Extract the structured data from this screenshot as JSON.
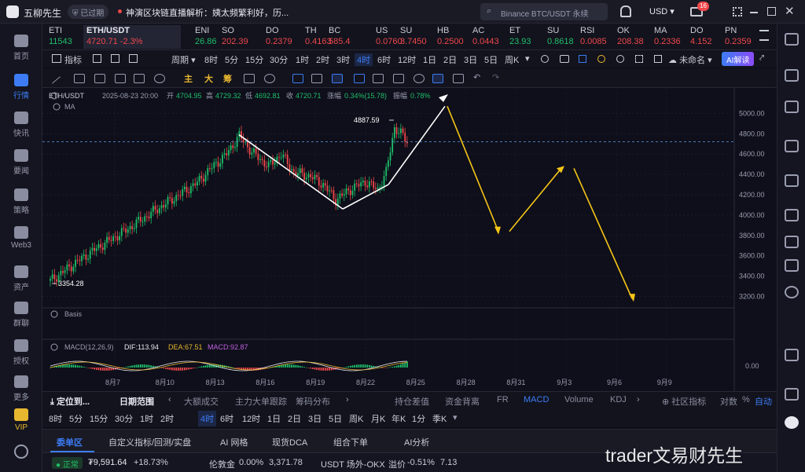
{
  "titlebar": {
    "app_name": "五柳先生",
    "expired_badge": "已过期",
    "news": "神演区块链直播解析：姨太频繁利好，历...",
    "search_placeholder": "Binance BTC/USDT 永续",
    "currency": "USD",
    "mail_count": "16"
  },
  "leftnav": [
    {
      "label": "首页"
    },
    {
      "label": "行情"
    },
    {
      "label": "快讯"
    },
    {
      "label": "要闻"
    },
    {
      "label": "策略"
    },
    {
      "label": "Web3"
    },
    {
      "label": "资产"
    },
    {
      "label": "群聊"
    },
    {
      "label": "授权"
    },
    {
      "label": "更多"
    },
    {
      "label": "VIP"
    }
  ],
  "ticker": [
    {
      "name": "ETI",
      "price": "11543",
      "change": ""
    },
    {
      "name": "ETH/USDT",
      "price": "4720.71",
      "change": "-2.3%"
    },
    {
      "name": "ENI",
      "price": "26.86",
      "change": ""
    },
    {
      "name": "SO",
      "price": "202.39",
      "change": ""
    },
    {
      "name": "DO",
      "price": "0.2379",
      "change": ""
    },
    {
      "name": "TH",
      "price": "0.4163",
      "change": ""
    },
    {
      "name": "BC",
      "price": "585.4",
      "change": ""
    },
    {
      "name": "US",
      "price": "0.0760",
      "change": ""
    },
    {
      "name": "SU",
      "price": "3.7450",
      "change": ""
    },
    {
      "name": "HB",
      "price": "0.2500",
      "change": ""
    },
    {
      "name": "AC",
      "price": "0.0443",
      "change": ""
    },
    {
      "name": "ET",
      "price": "23.93",
      "change": ""
    },
    {
      "name": "SU",
      "price": "0.8618",
      "change": ""
    },
    {
      "name": "RSI",
      "price": "0.0085",
      "change": ""
    },
    {
      "name": "OK",
      "price": "208.38",
      "change": ""
    },
    {
      "name": "MA",
      "price": "0.2336",
      "change": ""
    },
    {
      "name": "DO",
      "price": "4.152",
      "change": ""
    },
    {
      "name": "PN",
      "price": "0.2359",
      "change": ""
    }
  ],
  "toolbar1": {
    "indicators": "指标",
    "period_label": "周期",
    "periods": [
      "8时",
      "5分",
      "15分",
      "30分",
      "1时",
      "2时",
      "3时",
      "4时",
      "6时",
      "12时",
      "1日",
      "2日",
      "3日",
      "5日",
      "周K"
    ],
    "active_period": "4时",
    "unnamed": "未命名",
    "ai_read": "AI解读"
  },
  "toolbar2": {
    "tags": [
      "主",
      "大",
      "筹"
    ]
  },
  "chart_data": {
    "type": "candlestick",
    "symbol": "ETH/USDT",
    "info": {
      "datetime": "2025-08-23 20:00",
      "open_label": "开",
      "open": "4704.95",
      "high_label": "高",
      "high": "4729.32",
      "low_label": "低",
      "low": "4692.81",
      "close_label": "收",
      "close": "4720.71",
      "change_label": "涨幅",
      "change": "0.34%(15.78)",
      "amp_label": "振幅",
      "amp": "0.78%"
    },
    "ma_label": "MA",
    "ylim": [
      3150,
      5080
    ],
    "yticks": [
      5000,
      4800,
      4600,
      4400,
      4200,
      4000,
      3800,
      3600,
      3400,
      3200
    ],
    "xticks": [
      "8月7",
      "8月10",
      "8月13",
      "8月16",
      "8月19",
      "8月22",
      "8月25",
      "8月28",
      "8月31",
      "9月3",
      "9月6",
      "9月9"
    ],
    "max_label": "4887.59",
    "min_label": "3354.28",
    "current_price": 4720.71,
    "basis_label": "Basis",
    "macd": {
      "label": "MACD(12,26,9)",
      "dif_label": "DIF:113.94",
      "dea_label": "DEA:67.51",
      "macd_label": "MACD:92.87",
      "ytick": "0.00"
    }
  },
  "bottom1": {
    "locate": "定位到...",
    "date_range": "日期范围",
    "tabs": [
      "大额成交",
      "主力大单跟踪",
      "筹码分布",
      "持仓差值",
      "资金背离",
      "FR",
      "MACD",
      "Volume",
      "KDJ"
    ],
    "active_tab": "MACD",
    "community": "社区指标",
    "log": "对数",
    "percent": "%",
    "auto": "自动"
  },
  "bottom2": {
    "periods": [
      "8时",
      "5分",
      "15分",
      "30分",
      "1时",
      "2时",
      "4时",
      "6时",
      "12时",
      "1日",
      "2日",
      "3日",
      "5日",
      "周K",
      "月K",
      "年K",
      "1分",
      "季K"
    ],
    "active": "4时"
  },
  "bottom3": {
    "tabs": [
      "委单区",
      "自定义指标/回测/实盘",
      "AI 网格",
      "现货DCA",
      "组合下单",
      "AI分析"
    ],
    "active": "委单区"
  },
  "statusbar": {
    "status": "正常",
    "balance": "₮9,591.64",
    "balance_change": "+18.73%",
    "gold_label": "伦敦金",
    "gold_change": "0.00%",
    "gold_price": "3,371.78",
    "otc_label": "USDT 场外-OKX",
    "premium_label": "溢价",
    "premium": "-0.51%",
    "otc_price": "7.13"
  },
  "watermark": "trader文易财先生",
  "colors": {
    "accent": "#3d7cf4",
    "up": "#1fbf6a",
    "down": "#f0474b",
    "projection": "#f5c518"
  }
}
